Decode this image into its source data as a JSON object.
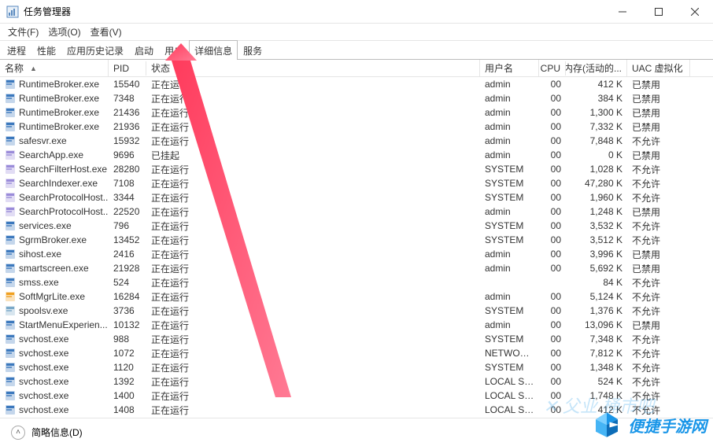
{
  "window": {
    "title": "任务管理器"
  },
  "menu": {
    "file": "文件(F)",
    "options": "选项(O)",
    "view": "查看(V)"
  },
  "tabs": {
    "items": [
      "进程",
      "性能",
      "应用历史记录",
      "启动",
      "用户",
      "详细信息",
      "服务"
    ],
    "active": 5
  },
  "columns": {
    "name": "名称",
    "pid": "PID",
    "status": "状态",
    "user": "用户名",
    "cpu": "CPU",
    "mem": "内存(活动的...",
    "uac": "UAC 虚拟化"
  },
  "rows": [
    {
      "name": "RuntimeBroker.exe",
      "pid": "15540",
      "status": "正在运行",
      "user": "admin",
      "cpu": "00",
      "mem": "412 K",
      "uac": "已禁用",
      "ico": "app"
    },
    {
      "name": "RuntimeBroker.exe",
      "pid": "7348",
      "status": "正在运行",
      "user": "admin",
      "cpu": "00",
      "mem": "384 K",
      "uac": "已禁用",
      "ico": "app"
    },
    {
      "name": "RuntimeBroker.exe",
      "pid": "21436",
      "status": "正在运行",
      "user": "admin",
      "cpu": "00",
      "mem": "1,300 K",
      "uac": "已禁用",
      "ico": "app"
    },
    {
      "name": "RuntimeBroker.exe",
      "pid": "21936",
      "status": "正在运行",
      "user": "admin",
      "cpu": "00",
      "mem": "7,332 K",
      "uac": "已禁用",
      "ico": "app"
    },
    {
      "name": "safesvr.exe",
      "pid": "15932",
      "status": "正在运行",
      "user": "admin",
      "cpu": "00",
      "mem": "7,848 K",
      "uac": "不允许",
      "ico": "app"
    },
    {
      "name": "SearchApp.exe",
      "pid": "9696",
      "status": "已挂起",
      "user": "admin",
      "cpu": "00",
      "mem": "0 K",
      "uac": "已禁用",
      "ico": "search"
    },
    {
      "name": "SearchFilterHost.exe",
      "pid": "28280",
      "status": "正在运行",
      "user": "SYSTEM",
      "cpu": "00",
      "mem": "1,028 K",
      "uac": "不允许",
      "ico": "search"
    },
    {
      "name": "SearchIndexer.exe",
      "pid": "7108",
      "status": "正在运行",
      "user": "SYSTEM",
      "cpu": "00",
      "mem": "47,280 K",
      "uac": "不允许",
      "ico": "search"
    },
    {
      "name": "SearchProtocolHost...",
      "pid": "3344",
      "status": "正在运行",
      "user": "SYSTEM",
      "cpu": "00",
      "mem": "1,960 K",
      "uac": "不允许",
      "ico": "search"
    },
    {
      "name": "SearchProtocolHost...",
      "pid": "22520",
      "status": "正在运行",
      "user": "admin",
      "cpu": "00",
      "mem": "1,248 K",
      "uac": "已禁用",
      "ico": "search"
    },
    {
      "name": "services.exe",
      "pid": "796",
      "status": "正在运行",
      "user": "SYSTEM",
      "cpu": "00",
      "mem": "3,532 K",
      "uac": "不允许",
      "ico": "app"
    },
    {
      "name": "SgrmBroker.exe",
      "pid": "13452",
      "status": "正在运行",
      "user": "SYSTEM",
      "cpu": "00",
      "mem": "3,512 K",
      "uac": "不允许",
      "ico": "app"
    },
    {
      "name": "sihost.exe",
      "pid": "2416",
      "status": "正在运行",
      "user": "admin",
      "cpu": "00",
      "mem": "3,996 K",
      "uac": "已禁用",
      "ico": "app"
    },
    {
      "name": "smartscreen.exe",
      "pid": "21928",
      "status": "正在运行",
      "user": "admin",
      "cpu": "00",
      "mem": "5,692 K",
      "uac": "已禁用",
      "ico": "app"
    },
    {
      "name": "smss.exe",
      "pid": "524",
      "status": "正在运行",
      "user": "",
      "cpu": "",
      "mem": "84 K",
      "uac": "不允许",
      "ico": "app"
    },
    {
      "name": "SoftMgrLite.exe",
      "pid": "16284",
      "status": "正在运行",
      "user": "admin",
      "cpu": "00",
      "mem": "5,124 K",
      "uac": "不允许",
      "ico": "soft"
    },
    {
      "name": "spoolsv.exe",
      "pid": "3736",
      "status": "正在运行",
      "user": "SYSTEM",
      "cpu": "00",
      "mem": "1,376 K",
      "uac": "不允许",
      "ico": "print"
    },
    {
      "name": "StartMenuExperien...",
      "pid": "10132",
      "status": "正在运行",
      "user": "admin",
      "cpu": "00",
      "mem": "13,096 K",
      "uac": "已禁用",
      "ico": "app"
    },
    {
      "name": "svchost.exe",
      "pid": "988",
      "status": "正在运行",
      "user": "SYSTEM",
      "cpu": "00",
      "mem": "7,348 K",
      "uac": "不允许",
      "ico": "app"
    },
    {
      "name": "svchost.exe",
      "pid": "1072",
      "status": "正在运行",
      "user": "NETWORK...",
      "cpu": "00",
      "mem": "7,812 K",
      "uac": "不允许",
      "ico": "app"
    },
    {
      "name": "svchost.exe",
      "pid": "1120",
      "status": "正在运行",
      "user": "SYSTEM",
      "cpu": "00",
      "mem": "1,348 K",
      "uac": "不允许",
      "ico": "app"
    },
    {
      "name": "svchost.exe",
      "pid": "1392",
      "status": "正在运行",
      "user": "LOCAL SE...",
      "cpu": "00",
      "mem": "524 K",
      "uac": "不允许",
      "ico": "app"
    },
    {
      "name": "svchost.exe",
      "pid": "1400",
      "status": "正在运行",
      "user": "LOCAL SE...",
      "cpu": "00",
      "mem": "1,748 K",
      "uac": "不允许",
      "ico": "app"
    },
    {
      "name": "svchost.exe",
      "pid": "1408",
      "status": "正在运行",
      "user": "LOCAL SE...",
      "cpu": "00",
      "mem": "412 K",
      "uac": "不允许",
      "ico": "app"
    }
  ],
  "footer": {
    "less": "简略信息(D)"
  },
  "watermark": {
    "text": "便捷手游网"
  }
}
